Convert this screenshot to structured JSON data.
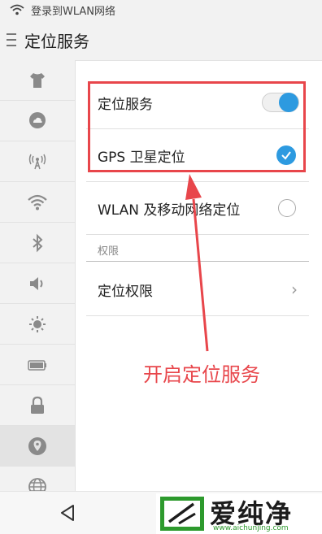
{
  "statusbar": {
    "text": "登录到WLAN网络",
    "icon": "wifi-icon"
  },
  "header": {
    "title": "定位服务",
    "menu_icon": "menu-icon"
  },
  "sidebar": {
    "items": [
      {
        "icon": "theme-shirt-icon",
        "active": false
      },
      {
        "icon": "cloud-account-icon",
        "active": false
      },
      {
        "icon": "antenna-icon",
        "active": false
      },
      {
        "icon": "wifi-icon",
        "active": false
      },
      {
        "icon": "bluetooth-icon",
        "active": false
      },
      {
        "icon": "volume-icon",
        "active": false
      },
      {
        "icon": "brightness-icon",
        "active": false
      },
      {
        "icon": "battery-icon",
        "active": false
      },
      {
        "icon": "lock-icon",
        "active": false
      },
      {
        "icon": "location-pin-icon",
        "active": true
      },
      {
        "icon": "globe-icon",
        "active": false
      }
    ]
  },
  "settings": {
    "location_service": {
      "label": "定位服务",
      "enabled": true
    },
    "gps": {
      "label": "GPS 卫星定位",
      "checked": true
    },
    "wlan_location": {
      "label": "WLAN 及移动网络定位",
      "checked": false
    },
    "section_permissions": "权限",
    "location_permissions": {
      "label": "定位权限"
    }
  },
  "annotation": {
    "text": "开启定位服务",
    "color": "#e8464b"
  },
  "watermark": {
    "brand": "爱纯净",
    "url": "www.aichunjing.com"
  },
  "colors": {
    "accent": "#2d9ae0",
    "highlight": "#e8464b",
    "logo_green": "#2d9a2d"
  }
}
